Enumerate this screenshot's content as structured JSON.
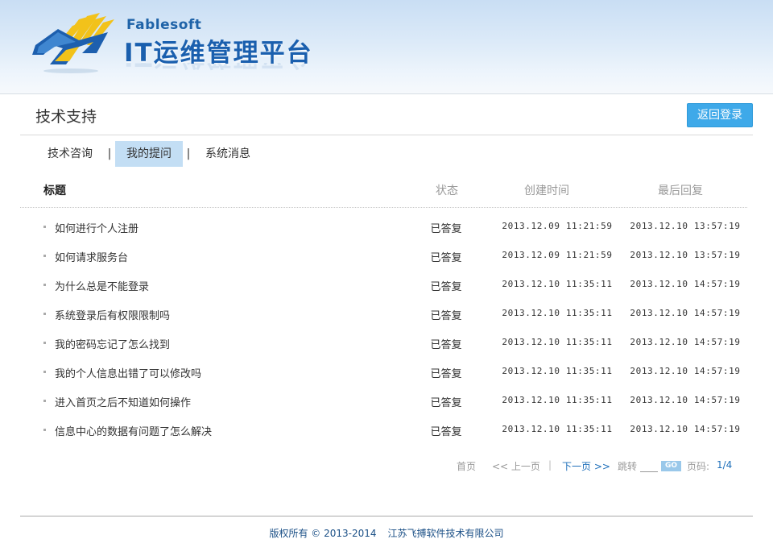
{
  "header": {
    "brand_en": "Fablesoft",
    "brand_cn": "IT运维管理平台"
  },
  "page": {
    "title": "技术支持",
    "back_button": "返回登录"
  },
  "tabs": [
    {
      "label": "技术咨询",
      "active": false
    },
    {
      "label": "我的提问",
      "active": true
    },
    {
      "label": "系统消息",
      "active": false
    }
  ],
  "tab_separator": "|",
  "table": {
    "columns": {
      "title": "标题",
      "status": "状态",
      "created": "创建时间",
      "last_reply": "最后回复"
    },
    "rows": [
      {
        "title": "如何进行个人注册",
        "status": "已答复",
        "created": "2013.12.09 11:21:59",
        "last_reply": "2013.12.10 13:57:19"
      },
      {
        "title": "如何请求服务台",
        "status": "已答复",
        "created": "2013.12.09 11:21:59",
        "last_reply": "2013.12.10 13:57:19"
      },
      {
        "title": "为什么总是不能登录",
        "status": "已答复",
        "created": "2013.12.10 11:35:11",
        "last_reply": "2013.12.10 14:57:19"
      },
      {
        "title": "系统登录后有权限限制吗",
        "status": "已答复",
        "created": "2013.12.10 11:35:11",
        "last_reply": "2013.12.10 14:57:19"
      },
      {
        "title": "我的密码忘记了怎么找到",
        "status": "已答复",
        "created": "2013.12.10 11:35:11",
        "last_reply": "2013.12.10 14:57:19"
      },
      {
        "title": "我的个人信息出错了可以修改吗",
        "status": "已答复",
        "created": "2013.12.10 11:35:11",
        "last_reply": "2013.12.10 14:57:19"
      },
      {
        "title": "进入首页之后不知道如何操作",
        "status": "已答复",
        "created": "2013.12.10 11:35:11",
        "last_reply": "2013.12.10 14:57:19"
      },
      {
        "title": "信息中心的数据有问题了怎么解决",
        "status": "已答复",
        "created": "2013.12.10 11:35:11",
        "last_reply": "2013.12.10 14:57:19"
      }
    ]
  },
  "pagination": {
    "first": "首页",
    "prev": "<< 上一页",
    "separator": "|",
    "next": "下一页 >>",
    "jump": "跳转",
    "jump_value": "",
    "go": "GO",
    "page_label": "页码:",
    "page_value": "1/4"
  },
  "footer": {
    "copyright": "版权所有 © 2013-2014",
    "company": "江苏飞搏软件技术有限公司"
  },
  "colors": {
    "accent": "#3ea9e9",
    "active_tab": "#c3def4",
    "brand": "#1a5fae",
    "link": "#1e6fba"
  }
}
